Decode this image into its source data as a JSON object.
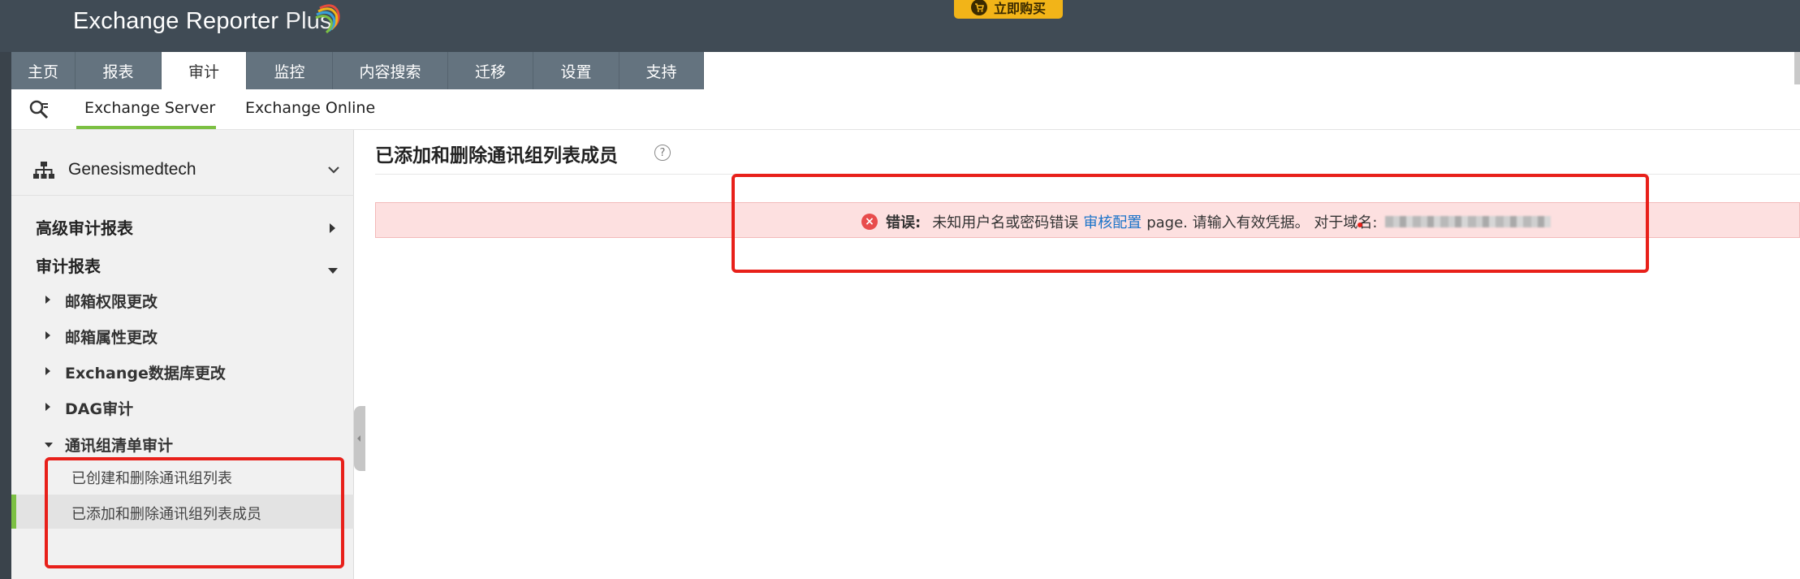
{
  "header": {
    "brand": "Exchange Reporter",
    "brand_plus": "Plus",
    "buy_label": "立即购买"
  },
  "tabs": [
    {
      "label": "主页"
    },
    {
      "label": "报表"
    },
    {
      "label": "审计"
    },
    {
      "label": "监控"
    },
    {
      "label": "内容搜索"
    },
    {
      "label": "迁移"
    },
    {
      "label": "设置"
    },
    {
      "label": "支持"
    }
  ],
  "subnav": {
    "tab_server": "Exchange Server",
    "tab_online": "Exchange Online"
  },
  "sidebar": {
    "org_name": "Genesismedtech",
    "section_advanced": "高级审计报表",
    "section_audit": "审计报表",
    "items": [
      {
        "label": "邮箱权限更改"
      },
      {
        "label": "邮箱属性更改"
      },
      {
        "label": "Exchange数据库更改"
      },
      {
        "label": "DAG审计"
      },
      {
        "label": "通讯组清单审计"
      }
    ],
    "leaves": [
      {
        "label": "已创建和删除通讯组列表"
      },
      {
        "label": "已添加和删除通讯组列表成员"
      }
    ]
  },
  "content": {
    "title": "已添加和删除通讯组列表成员",
    "help": "?",
    "error": {
      "label": "错误:",
      "message": "未知用户名或密码错误",
      "link": "审核配置",
      "after_link": "page. 请输入有效凭据。 对于域名:"
    }
  },
  "colors": {
    "header_bg": "#404b55",
    "tab_bg": "#64737f",
    "accent_green": "#7cc043",
    "buy_yellow": "#f2b418",
    "error_bg": "#fde0e0",
    "annotation_red": "#e8201a",
    "link_blue": "#1a73c9"
  }
}
